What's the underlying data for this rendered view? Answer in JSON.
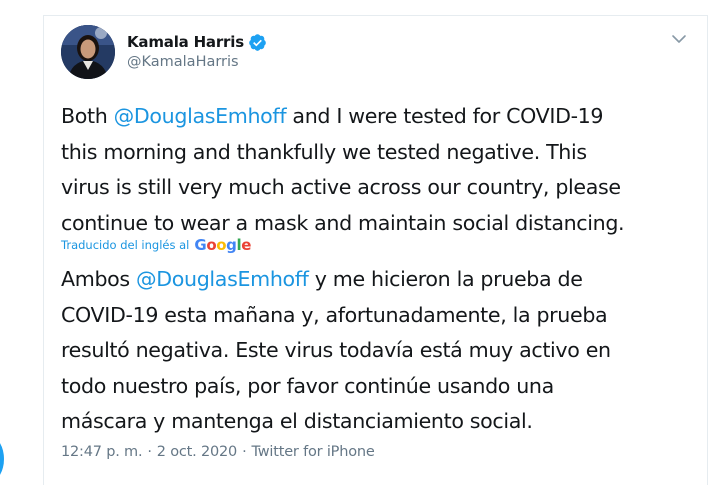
{
  "author": {
    "name": "Kamala Harris",
    "handle": "@KamalaHarris"
  },
  "tweet": {
    "lines": [
      {
        "before": "Both ",
        "mention": "@DouglasEmhoff",
        "after": " and I were tested for COVID-19"
      },
      {
        "text": "this morning and thankfully we tested negative. This"
      },
      {
        "text": "virus is still very much active across our country, please"
      },
      {
        "text": "continue to wear a mask and maintain social distancing."
      }
    ]
  },
  "translation": {
    "label": "Traducido del inglés al",
    "provider": "Google",
    "lines": [
      {
        "before": "Ambos ",
        "mention": "@DouglasEmhoff",
        "after": " y me hicieron la prueba de"
      },
      {
        "text": "COVID-19 esta mañana y, afortunadamente, la prueba"
      },
      {
        "text": "resultó negativa. Este virus todavía está muy activo en"
      },
      {
        "text": "todo nuestro país, por favor continúe usando una"
      },
      {
        "text": "máscara y mantenga el distanciamiento social."
      }
    ]
  },
  "meta": {
    "time": "12:47 p. m.",
    "separator1": "·",
    "date": "2 oct. 2020",
    "separator2": "·",
    "source": "Twitter for iPhone"
  },
  "icons": {
    "verified": "verified-badge-icon",
    "caret": "chevron-down-icon"
  },
  "colors": {
    "link": "#1b95e0",
    "text": "#14171a",
    "secondary": "#657786",
    "verified": "#1da1f2"
  }
}
